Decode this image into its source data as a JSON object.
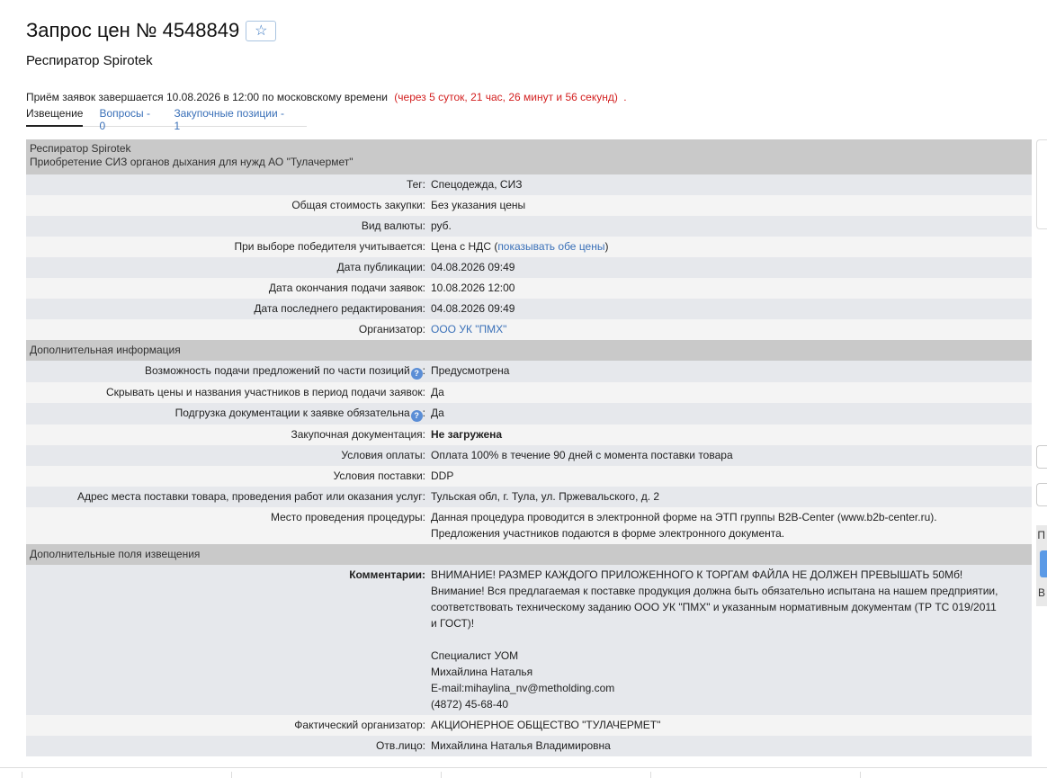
{
  "header": {
    "title": "Запрос цен № 4548849",
    "star_icon": "☆",
    "subtitle": "Респиратор Spirotek"
  },
  "deadline": {
    "text": "Приём заявок завершается 10.08.2026 в 12:00 по московскому времени",
    "countdown": "(через 5 суток, 21 час, 26 минут и 56 секунд)",
    "dot": "."
  },
  "tabs": [
    {
      "label": "Извещение"
    },
    {
      "label": "Вопросы - 0"
    },
    {
      "label": "Закупочные позиции - 1"
    }
  ],
  "notice": {
    "head_line1": "Респиратор Spirotek",
    "head_line2": "Приобретение СИЗ органов дыхания для нужд АО \"Тулачермет\"",
    "tag_label": "Тег:",
    "tag_value": "Спецодежда, СИЗ",
    "cost_label": "Общая стоимость закупки:",
    "cost_value": "Без указания цены",
    "currency_label": "Вид валюты:",
    "currency_value": "руб.",
    "winner_label": "При выборе победителя учитывается:",
    "winner_value": "Цена с НДС (",
    "winner_link": "показывать обе цены",
    "winner_close": ")",
    "pub_label": "Дата публикации:",
    "pub_value": "04.08.2026 09:49",
    "end_label": "Дата окончания подачи заявок:",
    "end_value": "10.08.2026 12:00",
    "edit_label": "Дата последнего редактирования:",
    "edit_value": "04.08.2026 09:49",
    "org_label": "Организатор:",
    "org_value": "ООО УК \"ПМХ\""
  },
  "additional": {
    "title": "Дополнительная информация",
    "partial_label": "Возможность подачи предложений по части позиций",
    "partial_value": "Предусмотрена",
    "hide_label": "Скрывать цены и названия участников в период подачи заявок:",
    "hide_value": "Да",
    "upload_label": "Подгрузка документации к заявке обязательна",
    "upload_value": "Да",
    "docs_label": "Закупочная документация:",
    "docs_value": "Не загружена",
    "payment_label": "Условия оплаты:",
    "payment_value": "Оплата 100% в течение 90 дней с момента поставки товара",
    "delivery_label": "Условия поставки:",
    "delivery_value": "DDP",
    "address_label": "Адрес места поставки товара, проведения работ или оказания услуг:",
    "address_value": "Тульская обл, г. Тула, ул. Пржевальского, д. 2",
    "place_label": "Место проведения процедуры:",
    "place_value_1": "Данная процедура проводится в электронной форме на ЭТП группы B2B-Center (www.b2b-center.ru).",
    "place_value_2": "Предложения участников подаются в форме электронного документа."
  },
  "extra": {
    "title": "Дополнительные поля извещения",
    "comment_label": "Комментарии:",
    "comment_lines": [
      "ВНИМАНИЕ! РАЗМЕР КАЖДОГО ПРИЛОЖЕННОГО К ТОРГАМ ФАЙЛА НЕ ДОЛЖЕН ПРЕВЫШАТЬ 50Мб!",
      "Внимание! Вся предлагаемая к поставке продукция должна быть обязательно испытана на нашем предприятии,",
      "соответствовать техническому заданию ООО УК \"ПМХ\" и указанным нормативным документам (ТР ТС 019/2011",
      "и ГОСТ)!",
      "",
      "Специалист УОМ",
      "Михайлина Наталья",
      "E-mail:mihaylina_nv@metholding.com",
      "(4872) 45-68-40"
    ],
    "actual_org_label": "Фактический организатор:",
    "actual_org_value": "АКЦИОНЕРНОЕ ОБЩЕСТВО \"ТУЛАЧЕРМЕТ\"",
    "resp_label": "Отв.лицо:",
    "resp_value": "Михайлина Наталья Владимировна"
  },
  "right_edge": {
    "letter1": "П",
    "letter2": "В"
  },
  "icons": {
    "help": "?"
  }
}
